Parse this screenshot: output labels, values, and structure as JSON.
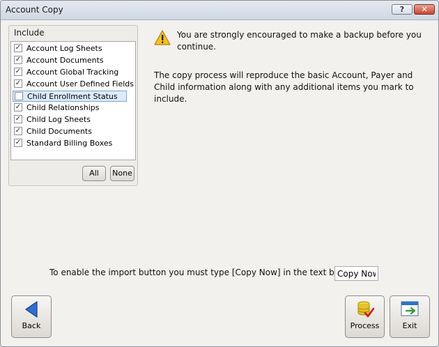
{
  "window": {
    "title": "Account Copy",
    "help_label": "?",
    "close_label": "✕"
  },
  "include": {
    "label": "Include",
    "items": [
      {
        "label": "Account Log Sheets",
        "checked": true
      },
      {
        "label": "Account Documents",
        "checked": true
      },
      {
        "label": "Account Global Tracking",
        "checked": true
      },
      {
        "label": "Account User Defined Fields",
        "checked": true
      },
      {
        "label": "Child Enrollment Status",
        "checked": false,
        "selected": true
      },
      {
        "label": "Child Relationships",
        "checked": true
      },
      {
        "label": "Child Log Sheets",
        "checked": true
      },
      {
        "label": "Child Documents",
        "checked": true
      },
      {
        "label": "Standard Billing Boxes",
        "checked": true
      }
    ],
    "all_label": "All",
    "none_label": "None"
  },
  "messages": {
    "warning": "You are strongly encouraged to make a backup before you continue.",
    "info": "The copy process will reproduce the basic Account, Payer and Child information along with any additional items you mark to include.",
    "enable": "To enable the import button you must type [Copy Now] in the text box"
  },
  "copy_input": {
    "value": "Copy Now"
  },
  "buttons": {
    "back": "Back",
    "process": "Process",
    "exit": "Exit"
  },
  "icons": {
    "warning": "warning-icon",
    "back": "back-arrow-icon",
    "process": "database-check-icon",
    "exit": "exit-icon"
  }
}
